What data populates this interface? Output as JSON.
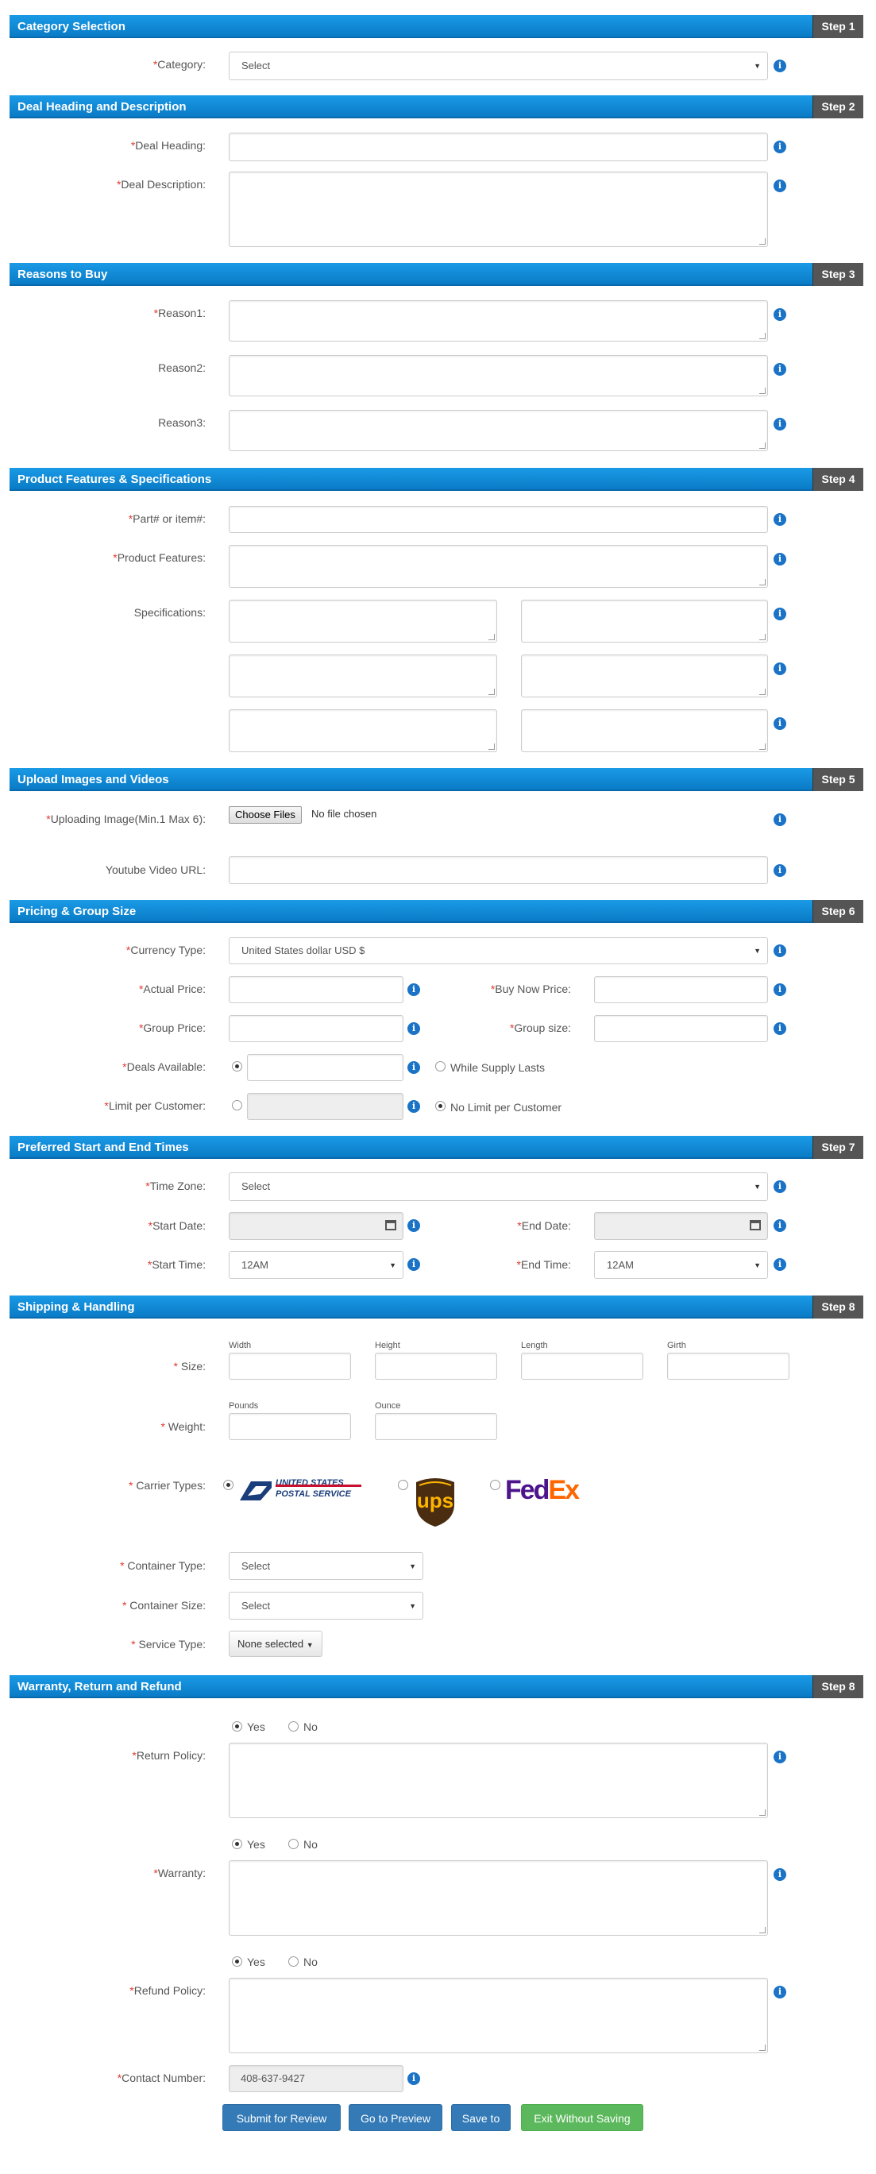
{
  "steps": [
    {
      "title": "Category Selection",
      "step": "Step 1"
    },
    {
      "title": "Deal Heading and Description",
      "step": "Step 2"
    },
    {
      "title": "Reasons to Buy",
      "step": "Step 3"
    },
    {
      "title": "Product Features & Specifications",
      "step": "Step 4"
    },
    {
      "title": "Upload Images and Videos",
      "step": "Step 5"
    },
    {
      "title": "Pricing & Group Size",
      "step": "Step 6"
    },
    {
      "title": "Preferred Start and End Times",
      "step": "Step 7"
    },
    {
      "title": "Shipping & Handling",
      "step": "Step 8"
    },
    {
      "title": "Warranty, Return and Refund",
      "step": "Step 8"
    }
  ],
  "category": {
    "label": "Category:",
    "value": "Select"
  },
  "deal": {
    "heading_label": "Deal Heading:",
    "description_label": "Deal Description:"
  },
  "reasons": {
    "r1": "Reason1:",
    "r2": "Reason2:",
    "r3": "Reason3:"
  },
  "features": {
    "part_label": "Part# or item#:",
    "features_label": "Product Features:",
    "specs_label": "Specifications:"
  },
  "upload": {
    "image_label": "Uploading Image(Min.1 Max 6):",
    "choose_btn": "Choose Files",
    "no_file": "No file chosen",
    "youtube_label": "Youtube Video URL:"
  },
  "pricing": {
    "currency_label": "Currency Type:",
    "currency_value": "United States dollar USD $",
    "actual_label": "Actual Price:",
    "buynow_label": "Buy Now Price:",
    "group_price_label": "Group Price:",
    "group_size_label": "Group size:",
    "deals_label": "Deals Available:",
    "supply_label": "While Supply Lasts",
    "limit_label": "Limit per Customer:",
    "nolimit_label": "No Limit per Customer"
  },
  "times": {
    "tz_label": "Time Zone:",
    "tz_value": "Select",
    "start_date_label": "Start Date:",
    "end_date_label": "End Date:",
    "start_time_label": "Start Time:",
    "start_time_value": "12AM",
    "end_time_label": "End Time:",
    "end_time_value": "12AM"
  },
  "shipping": {
    "size_label": "Size:",
    "width": "Width",
    "height": "Height",
    "length": "Length",
    "girth": "Girth",
    "weight_label": "Weight:",
    "pounds": "Pounds",
    "ounce": "Ounce",
    "carrier_label": "Carrier Types:",
    "usps_line1": "UNITED STATES",
    "usps_line2": "POSTAL SERVICE",
    "ups": "ups",
    "fedex_fed": "Fed",
    "fedex_ex": "Ex",
    "container_type_label": "Container Type:",
    "container_type_value": "Select",
    "container_size_label": "Container Size:",
    "container_size_value": "Select",
    "service_label": "Service Type:",
    "service_value": "None selected"
  },
  "warranty": {
    "yes": "Yes",
    "no": "No",
    "return_label": "Return Policy:",
    "warranty_label": "Warranty:",
    "refund_label": "Refund Policy:",
    "contact_label": "Contact Number:",
    "contact_value": "408-637-9427"
  },
  "buttons": {
    "submit": "Submit for Review",
    "preview": "Go to Preview",
    "save": "Save to",
    "exit": "Exit Without Saving"
  },
  "colors": {
    "header": "#0a7bc6",
    "required": "#e03a2f",
    "green": "#5cb85c",
    "blue": "#337ab7",
    "usps": "#1a3d7c",
    "ups": "#ffb500",
    "fedex_purple": "#4d148c",
    "fedex_orange": "#ff6600"
  }
}
